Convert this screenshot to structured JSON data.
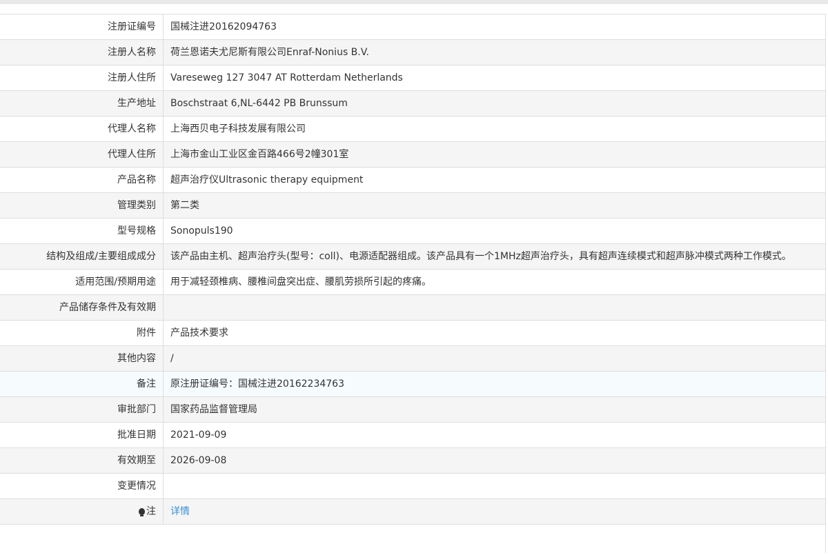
{
  "rows": [
    {
      "label": "注册证编号",
      "value": "国械注进20162094763"
    },
    {
      "label": "注册人名称",
      "value": "荷兰恩诺夫尤尼斯有限公司Enraf-Nonius B.V."
    },
    {
      "label": "注册人住所",
      "value": "Vareseweg 127 3047 AT Rotterdam Netherlands"
    },
    {
      "label": "生产地址",
      "value": "Boschstraat 6,NL-6442 PB Brunssum"
    },
    {
      "label": "代理人名称",
      "value": "上海西贝电子科技发展有限公司"
    },
    {
      "label": "代理人住所",
      "value": "上海市金山工业区金百路466号2幢301室"
    },
    {
      "label": "产品名称",
      "value": "超声治疗仪Ultrasonic therapy equipment"
    },
    {
      "label": "管理类别",
      "value": "第二类"
    },
    {
      "label": "型号规格",
      "value": "Sonopuls190"
    },
    {
      "label": "结构及组成/主要组成成分",
      "value": "该产品由主机、超声治疗头(型号：coll)、电源适配器组成。该产品具有一个1MHz超声治疗头，具有超声连续模式和超声脉冲模式两种工作模式。"
    },
    {
      "label": "适用范围/预期用途",
      "value": "用于减轻颈椎病、腰椎间盘突出症、腰肌劳损所引起的疼痛。"
    },
    {
      "label": "产品储存条件及有效期",
      "value": ""
    },
    {
      "label": "附件",
      "value": "产品技术要求"
    },
    {
      "label": "其他内容",
      "value": "/"
    },
    {
      "label": "备注",
      "value": "原注册证编号：国械注进20162234763"
    },
    {
      "label": "审批部门",
      "value": "国家药品监督管理局"
    },
    {
      "label": "批准日期",
      "value": "2021-09-09"
    },
    {
      "label": "有效期至",
      "value": "2026-09-08"
    },
    {
      "label": "变更情况",
      "value": ""
    },
    {
      "label": "注",
      "value": "详情"
    }
  ],
  "icons": {
    "note": "lightbulb-icon"
  },
  "colors": {
    "link": "#3b8fd6",
    "border": "#dddddd",
    "row_alt": "#f5f5f5"
  }
}
